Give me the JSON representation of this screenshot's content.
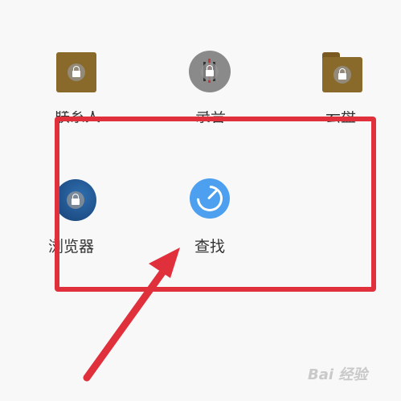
{
  "apps": {
    "contacts": {
      "label": "联系人",
      "icon": "contacts-icon"
    },
    "recorder": {
      "label": "录音",
      "icon": "recorder-icon"
    },
    "cloud": {
      "label": "云盘",
      "icon": "folder-icon"
    },
    "browser": {
      "label": "浏览器",
      "icon": "browser-icon"
    },
    "find": {
      "label": "查找",
      "icon": "find-compass-icon"
    }
  },
  "colors": {
    "highlight": "#e0303c",
    "arrow": "#e0303c",
    "background": "#f8f8f8"
  },
  "watermark": {
    "text": "Bai 经验"
  }
}
